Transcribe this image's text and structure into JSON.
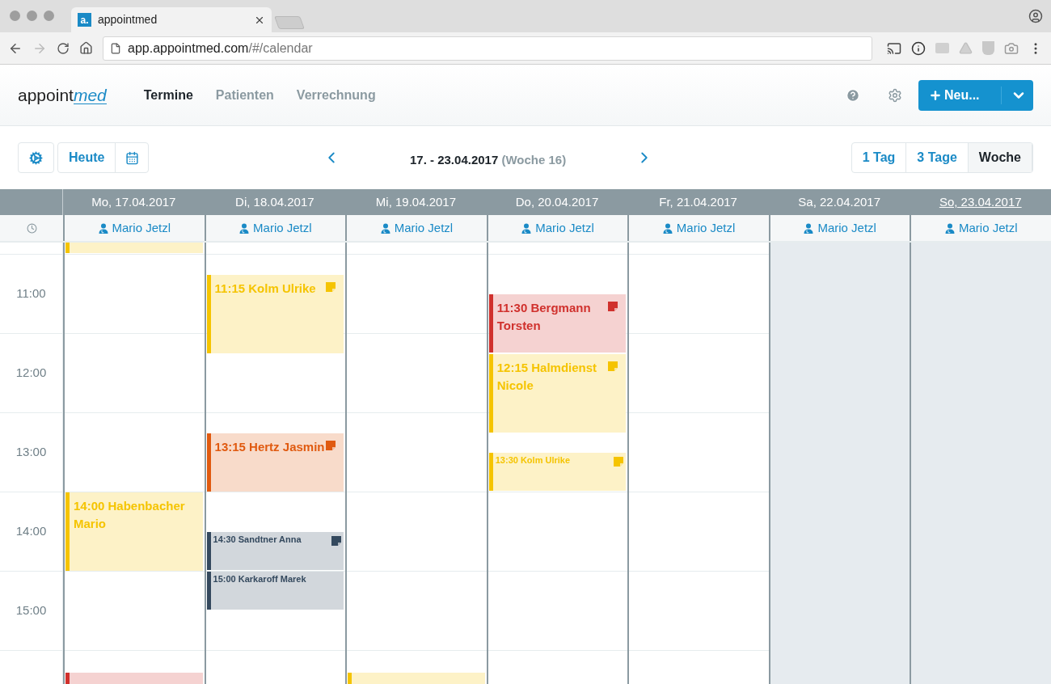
{
  "browser": {
    "tab_title": "appointmed",
    "favicon": "a.",
    "url_host": "app.appointmed.com",
    "url_path": "/#/calendar"
  },
  "app": {
    "logo": [
      "appoint",
      "med"
    ],
    "nav": [
      {
        "label": "Termine",
        "selected": true
      },
      {
        "label": "Patienten",
        "selected": false
      },
      {
        "label": "Verrechnung",
        "selected": false
      }
    ],
    "new_button": "Neu..."
  },
  "toolbar": {
    "today": "Heute",
    "range": "17. - 23.04.2017",
    "week": "(Woche 16)",
    "views": [
      {
        "label": "1 Tag",
        "selected": false
      },
      {
        "label": "3 Tage",
        "selected": false
      },
      {
        "label": "Woche",
        "selected": true
      }
    ]
  },
  "hours": [
    "11:00",
    "12:00",
    "13:00",
    "14:00",
    "15:00"
  ],
  "days": [
    {
      "label": "Mo, 17.04.2017",
      "today": false,
      "off_day": false,
      "doctor": "Mario Jetzl",
      "events": [
        {
          "kind": "cut-top",
          "color": "#f5c400"
        },
        {
          "kind": "hour",
          "time": "14:00",
          "name": "Habenbacher Mario",
          "color": "#f5c400",
          "note": false
        },
        {
          "kind": "cut-bottom",
          "color": "#d0312d"
        }
      ]
    },
    {
      "label": "Di, 18.04.2017",
      "today": false,
      "off_day": false,
      "doctor": "Mario Jetzl",
      "events": [
        {
          "kind": "hour",
          "time": "11:15",
          "name": "Kolm Ulrike",
          "color": "#f5c400",
          "note": true
        },
        {
          "kind": "three-quarter",
          "time": "13:15",
          "name": "Hertz Jasmin",
          "color": "#e05a10",
          "note": true
        },
        {
          "kind": "half-compact",
          "time": "14:30",
          "name": "Sandtner Anna",
          "color": "#34495e",
          "note": true
        },
        {
          "kind": "half-compact",
          "time": "15:00",
          "name": "Karkaroff Marek",
          "color": "#34495e",
          "note": false
        }
      ]
    },
    {
      "label": "Mi, 19.04.2017",
      "today": false,
      "off_day": false,
      "doctor": "Mario Jetzl",
      "events": [
        {
          "kind": "cut-bottom",
          "color": "#f5c400"
        }
      ]
    },
    {
      "label": "Do, 20.04.2017",
      "today": false,
      "off_day": false,
      "doctor": "Mario Jetzl",
      "events": [
        {
          "kind": "three-quarter",
          "time": "11:30",
          "name": "Bergmann Torsten",
          "color": "#d0312d",
          "note": true
        },
        {
          "kind": "hour",
          "time": "12:15",
          "name": "Halmdienst Nicole",
          "color": "#f5c400",
          "note": true
        },
        {
          "kind": "half-compact",
          "time": "13:30",
          "name": "Kolm Ulrike",
          "color": "#f5c400",
          "note": true
        }
      ]
    },
    {
      "label": "Fr, 21.04.2017",
      "today": false,
      "off_day": false,
      "doctor": "Mario Jetzl"
    },
    {
      "label": "Sa, 22.04.2017",
      "today": false,
      "off_day": true,
      "doctor": "Mario Jetzl"
    },
    {
      "label": "So, 23.04.2017",
      "today": true,
      "off_day": true,
      "doctor": "Mario Jetzl"
    }
  ]
}
